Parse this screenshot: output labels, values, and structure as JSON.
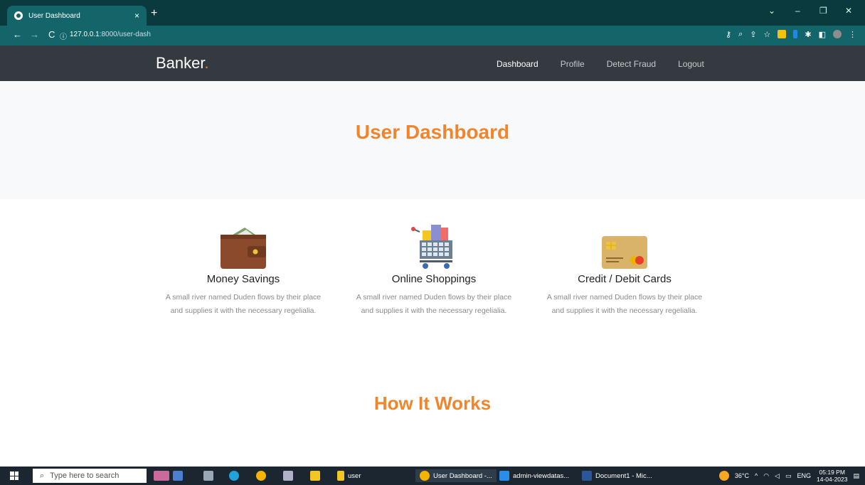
{
  "browser": {
    "tab_title": "User Dashboard",
    "tab_close": "×",
    "new_tab": "+",
    "url_host": "127.0.0.1",
    "url_path": ":8000/user-dash",
    "window_controls": [
      "⌄",
      "–",
      "❐",
      "✕"
    ]
  },
  "navbar": {
    "brand": "Banker",
    "brand_dot": ".",
    "items": [
      {
        "label": "Dashboard",
        "active": true
      },
      {
        "label": "Profile",
        "active": false
      },
      {
        "label": "Detect Fraud",
        "active": false
      },
      {
        "label": "Logout",
        "active": false
      }
    ]
  },
  "hero": {
    "title": "User Dashboard"
  },
  "services": [
    {
      "icon": "wallet-icon",
      "title": "Money Savings",
      "description": "A small river named Duden flows by their place and supplies it with the necessary regelialia."
    },
    {
      "icon": "shopping-cart-icon",
      "title": "Online Shoppings",
      "description": "A small river named Duden flows by their place and supplies it with the necessary regelialia."
    },
    {
      "icon": "credit-card-icon",
      "title": "Credit / Debit Cards",
      "description": "A small river named Duden flows by their place and supplies it with the necessary regelialia."
    }
  ],
  "section2": {
    "title": "How It Works"
  },
  "taskbar": {
    "search_placeholder": "Type here to search",
    "folder_label": "user",
    "chrome_label": "User Dashboard -...",
    "vscode_label": "admin-viewdatas...",
    "word_label": "Document1 - Mic...",
    "temperature": "36°C",
    "language": "ENG",
    "time": "05:19 PM",
    "date": "14-04-2023"
  },
  "colors": {
    "accent": "#f0852d",
    "navbar_bg": "#343a40",
    "browser_bg": "#136569"
  }
}
